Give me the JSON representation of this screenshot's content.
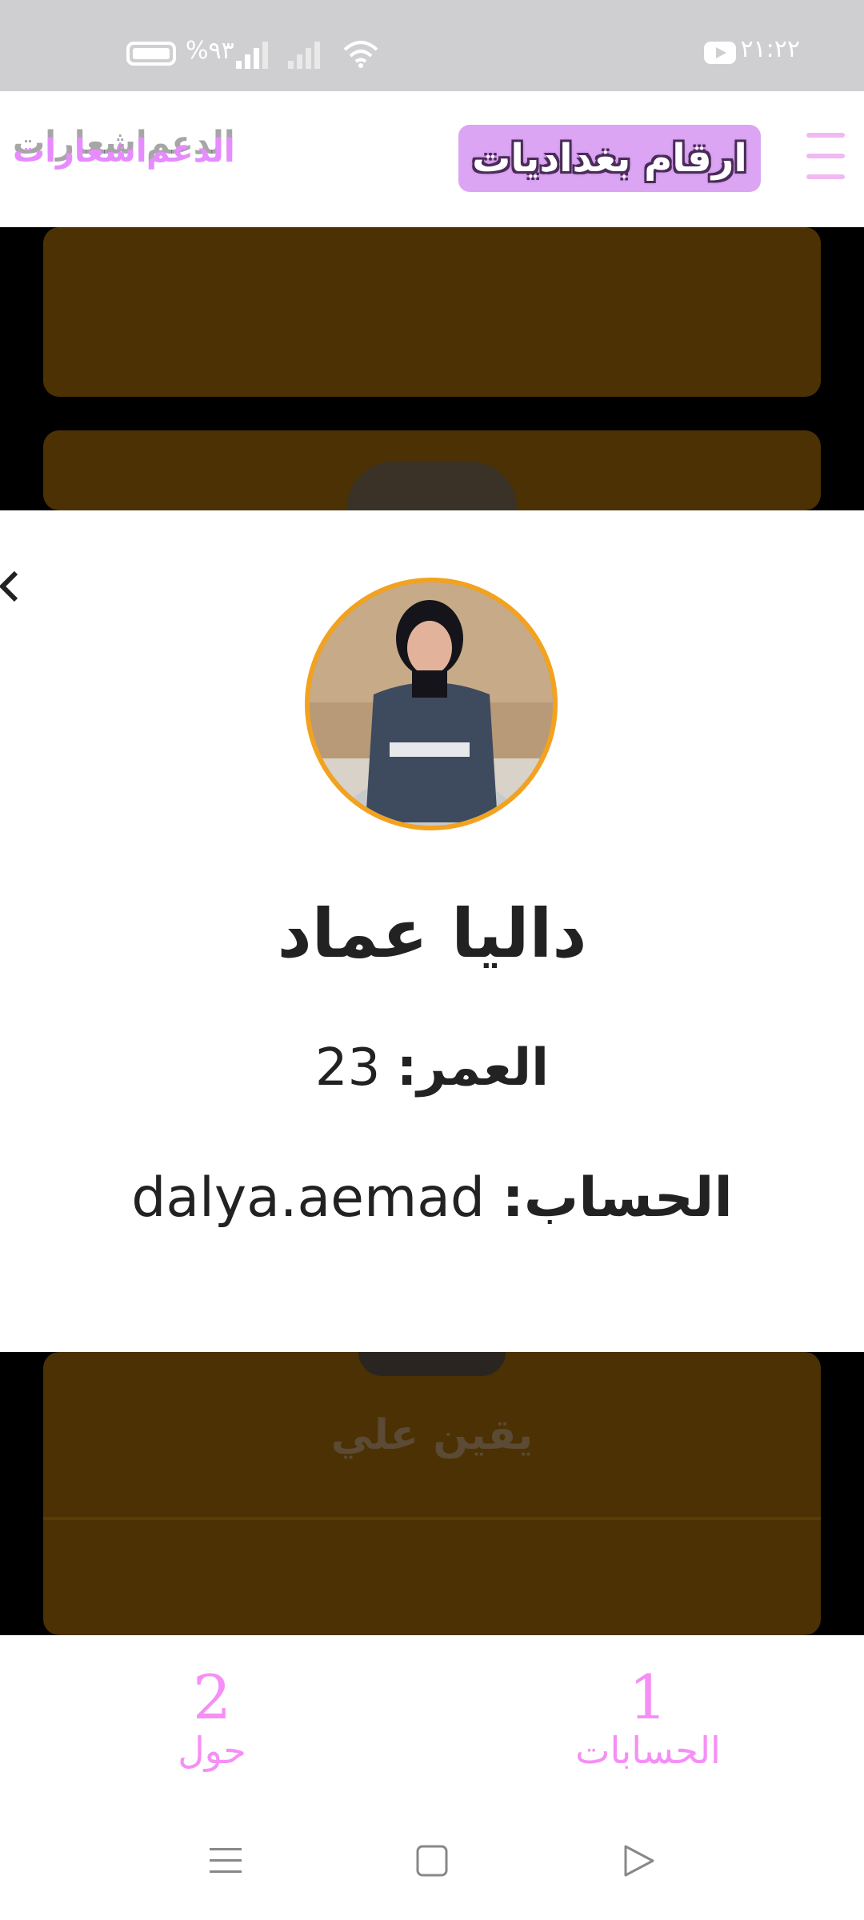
{
  "status_bar": {
    "time": "٢١:٢٢",
    "battery_percent": "%٩٣",
    "icons": [
      "youtube-icon",
      "battery-icon",
      "signal-icon",
      "wifi-icon"
    ]
  },
  "header": {
    "brand": "ارقام بغداديات",
    "nav_support": "الدعم",
    "nav_notifications": "اشعارات",
    "accent_color": "#dca5f4"
  },
  "profile": {
    "name": "داليا عماد",
    "age_label": "العمر:",
    "age_value": "23",
    "account_label": "الحساب:",
    "account_value": "dalya.aemad"
  },
  "background_card": {
    "name": "يقين علي"
  },
  "bottom_nav": {
    "items": [
      {
        "number": "1",
        "label": "الحسابات"
      },
      {
        "number": "2",
        "label": "حول"
      }
    ],
    "color": "#f68ff5"
  },
  "system_nav": [
    "menu-icon",
    "home-square-icon",
    "back-triangle-icon"
  ]
}
